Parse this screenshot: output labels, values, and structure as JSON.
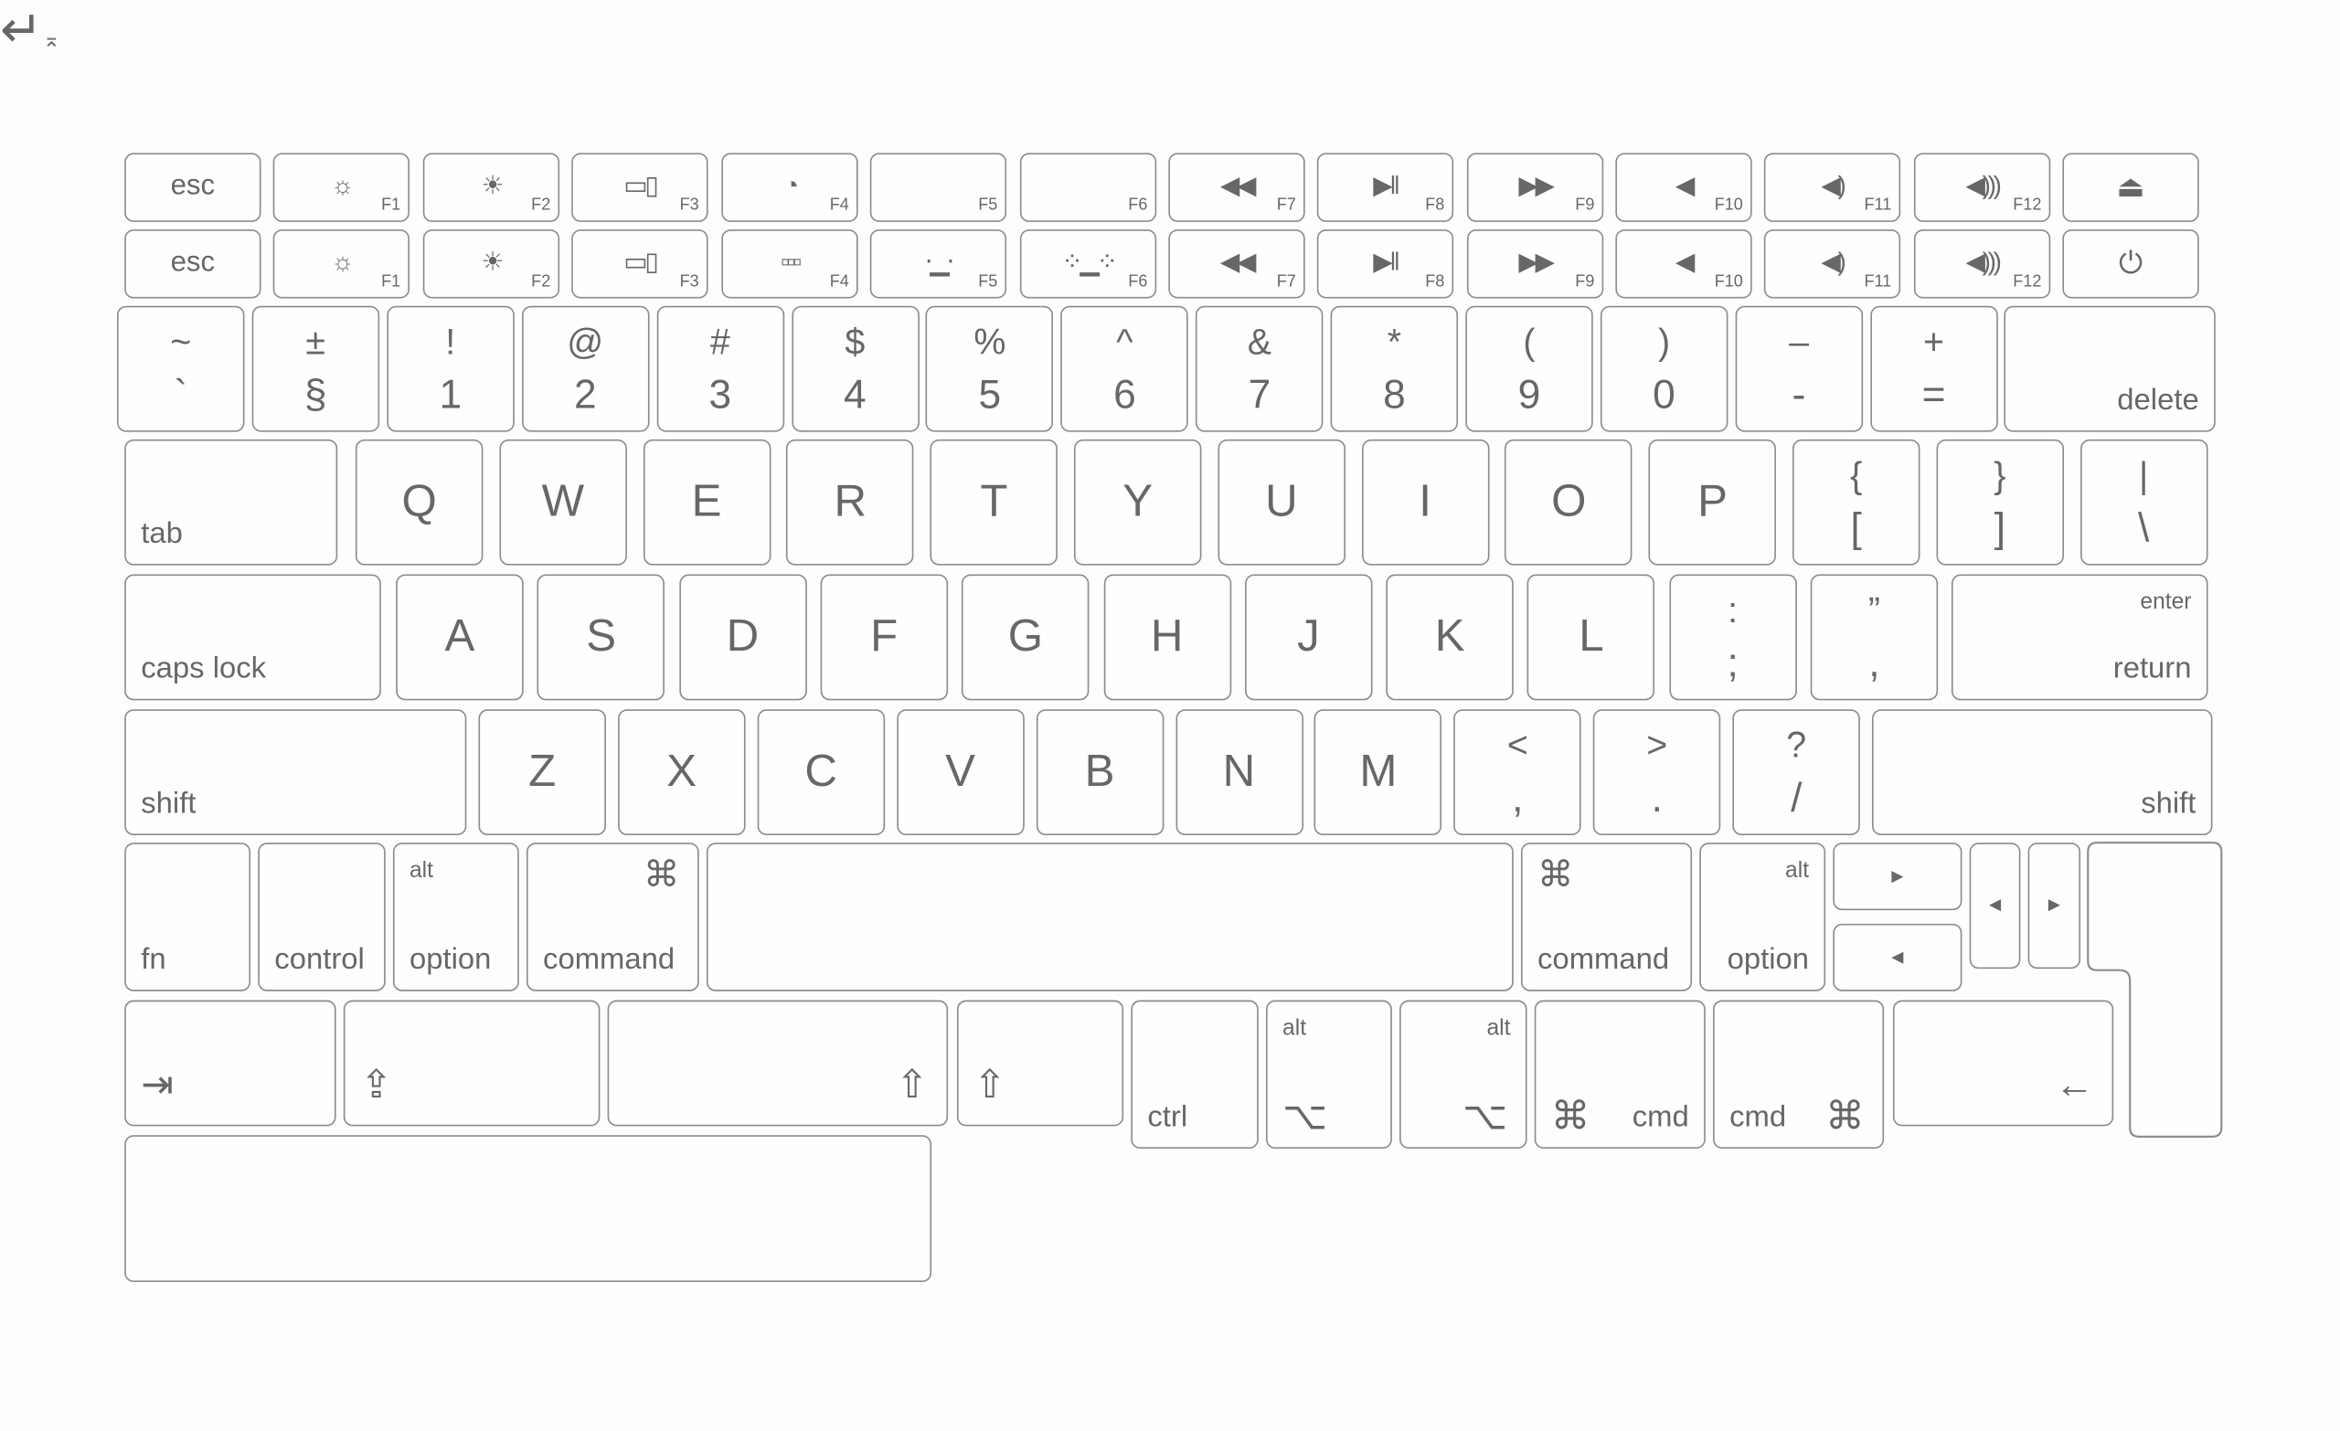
{
  "colors": {
    "key_border": "#8c8c8c",
    "label": "#676767",
    "background": "#fdfdfd"
  },
  "rows": {
    "fn_row_1": [
      {
        "t": "esc"
      },
      {
        "icon": "brightness-low",
        "fn": "F1"
      },
      {
        "icon": "brightness-high",
        "fn": "F2"
      },
      {
        "icon": "mission-control",
        "fn": "F3"
      },
      {
        "icon": "dashboard",
        "fn": "F4"
      },
      {
        "fn": "F5"
      },
      {
        "fn": "F6"
      },
      {
        "icon": "rewind",
        "fn": "F7"
      },
      {
        "icon": "play-pause",
        "fn": "F8"
      },
      {
        "icon": "fast-forward",
        "fn": "F9"
      },
      {
        "icon": "mute",
        "fn": "F10"
      },
      {
        "icon": "volume-down",
        "fn": "F11"
      },
      {
        "icon": "volume-up",
        "fn": "F12"
      },
      {
        "icon": "eject"
      }
    ],
    "fn_row_2": [
      {
        "t": "esc"
      },
      {
        "icon": "brightness-low",
        "fn": "F1"
      },
      {
        "icon": "brightness-high",
        "fn": "F2"
      },
      {
        "icon": "mission-control",
        "fn": "F3"
      },
      {
        "icon": "launchpad",
        "fn": "F4"
      },
      {
        "icon": "keyboard-light-down",
        "fn": "F5"
      },
      {
        "icon": "keyboard-light-up",
        "fn": "F6"
      },
      {
        "icon": "rewind",
        "fn": "F7"
      },
      {
        "icon": "play-pause",
        "fn": "F8"
      },
      {
        "icon": "fast-forward",
        "fn": "F9"
      },
      {
        "icon": "mute",
        "fn": "F10"
      },
      {
        "icon": "volume-down",
        "fn": "F11"
      },
      {
        "icon": "volume-up",
        "fn": "F12"
      },
      {
        "icon": "power"
      }
    ],
    "number_row": [
      {
        "t": "~",
        "b": "`"
      },
      {
        "t": "±",
        "b": "§"
      },
      {
        "t": "!",
        "b": "1"
      },
      {
        "t": "@",
        "b": "2"
      },
      {
        "t": "#",
        "b": "3"
      },
      {
        "t": "$",
        "b": "4"
      },
      {
        "t": "%",
        "b": "5"
      },
      {
        "t": "^",
        "b": "6"
      },
      {
        "t": "&",
        "b": "7"
      },
      {
        "t": "*",
        "b": "8"
      },
      {
        "t": "(",
        "b": "9"
      },
      {
        "t": ")",
        "b": "0"
      },
      {
        "t": "–",
        "b": "-"
      },
      {
        "t": "+",
        "b": "="
      },
      {
        "b": "delete"
      }
    ],
    "qwerty_row": [
      {
        "b": "tab"
      },
      {
        "t": "Q"
      },
      {
        "t": "W"
      },
      {
        "t": "E"
      },
      {
        "t": "R"
      },
      {
        "t": "T"
      },
      {
        "t": "Y"
      },
      {
        "t": "U"
      },
      {
        "t": "I"
      },
      {
        "t": "O"
      },
      {
        "t": "P"
      },
      {
        "t": "{",
        "b": "["
      },
      {
        "t": "}",
        "b": "]"
      },
      {
        "t": "|",
        "b": "\\"
      }
    ],
    "home_row": [
      {
        "b": "caps lock"
      },
      {
        "t": "A"
      },
      {
        "t": "S"
      },
      {
        "t": "D"
      },
      {
        "t": "F"
      },
      {
        "t": "G"
      },
      {
        "t": "H"
      },
      {
        "t": "J"
      },
      {
        "t": "K"
      },
      {
        "t": "L"
      },
      {
        "t": ":",
        "b": ";"
      },
      {
        "t": "”",
        "b": ","
      },
      {
        "t": "enter",
        "b": "return"
      }
    ],
    "shift_row": [
      {
        "b": "shift"
      },
      {
        "t": "Z"
      },
      {
        "t": "X"
      },
      {
        "t": "C"
      },
      {
        "t": "V"
      },
      {
        "t": "B"
      },
      {
        "t": "N"
      },
      {
        "t": "M"
      },
      {
        "t": "<",
        "b": ","
      },
      {
        "t": ">",
        "b": "."
      },
      {
        "t": "?",
        "b": "/"
      },
      {
        "b": "shift"
      }
    ],
    "bottom_row": [
      {
        "b": "fn"
      },
      {
        "b": "control"
      },
      {
        "t": "alt",
        "b": "option"
      },
      {
        "icon": "command",
        "b": "command"
      },
      {
        "b": ""
      },
      {
        "icon": "command",
        "b": "command"
      },
      {
        "t": "alt",
        "b": "option"
      },
      {
        "icon": "arrow-right-small"
      },
      {
        "icon": "arrow-left-small"
      },
      {
        "icon": "arrow-left-small"
      },
      {
        "icon": "arrow-right-small"
      }
    ],
    "extra_row": [
      {
        "icon": "tab-arrow"
      },
      {
        "icon": "caps-lock-arrow"
      },
      {
        "icon": "shift-arrow"
      },
      {
        "icon": "shift-arrow"
      },
      {
        "b": "ctrl"
      },
      {
        "t": "alt",
        "icon": "option"
      },
      {
        "t": "alt",
        "icon": "option"
      },
      {
        "icon": "command",
        "b": "cmd"
      },
      {
        "icon": "command",
        "b": "cmd"
      },
      {
        "icon": "backspace-arrow"
      }
    ],
    "enter_key": {
      "icon": "return-arrow",
      "sub_icon": "enter-small"
    },
    "blank_key": {}
  }
}
